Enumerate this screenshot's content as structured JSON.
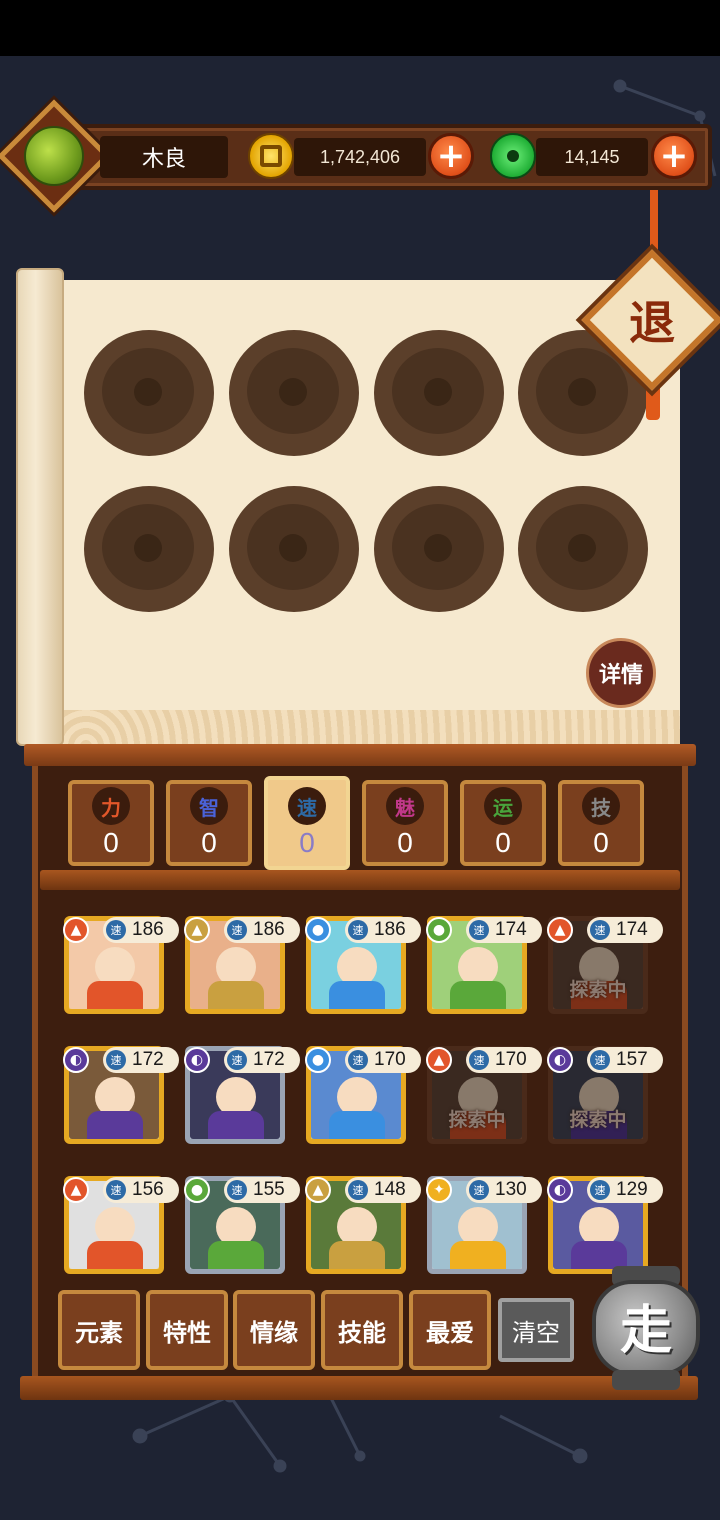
{
  "player": {
    "name": "木良"
  },
  "resources": {
    "gold": "1,742,406",
    "jade": "14,145"
  },
  "buttons": {
    "exit": "退",
    "detail": "详情",
    "go": "走",
    "clear": "清空"
  },
  "stats": [
    {
      "label": "力",
      "value": "0",
      "color": "#e2572a"
    },
    {
      "label": "智",
      "value": "0",
      "color": "#4a62d8"
    },
    {
      "label": "速",
      "value": "0",
      "color": "#2d6aa6"
    },
    {
      "label": "魅",
      "value": "0",
      "color": "#c2388a"
    },
    {
      "label": "运",
      "value": "0",
      "color": "#49a43c"
    },
    {
      "label": "技",
      "value": "0",
      "color": "#888888"
    }
  ],
  "cards": [
    {
      "element": "fire",
      "speed": "186",
      "status": ""
    },
    {
      "element": "earth",
      "speed": "186",
      "status": ""
    },
    {
      "element": "water",
      "speed": "186",
      "status": ""
    },
    {
      "element": "wood",
      "speed": "174",
      "status": ""
    },
    {
      "element": "fire",
      "speed": "174",
      "status": "探索中"
    },
    {
      "element": "dark",
      "speed": "172",
      "status": ""
    },
    {
      "element": "dark",
      "speed": "172",
      "status": ""
    },
    {
      "element": "water",
      "speed": "170",
      "status": ""
    },
    {
      "element": "fire",
      "speed": "170",
      "status": "探索中"
    },
    {
      "element": "dark",
      "speed": "157",
      "status": "探索中"
    },
    {
      "element": "fire",
      "speed": "156",
      "status": ""
    },
    {
      "element": "wood",
      "speed": "155",
      "status": ""
    },
    {
      "element": "earth",
      "speed": "148",
      "status": ""
    },
    {
      "element": "light",
      "speed": "130",
      "status": ""
    },
    {
      "element": "dark",
      "speed": "129",
      "status": ""
    }
  ],
  "speed_label": "速",
  "filters": [
    "元素",
    "特性",
    "情缘",
    "技能",
    "最爱"
  ]
}
